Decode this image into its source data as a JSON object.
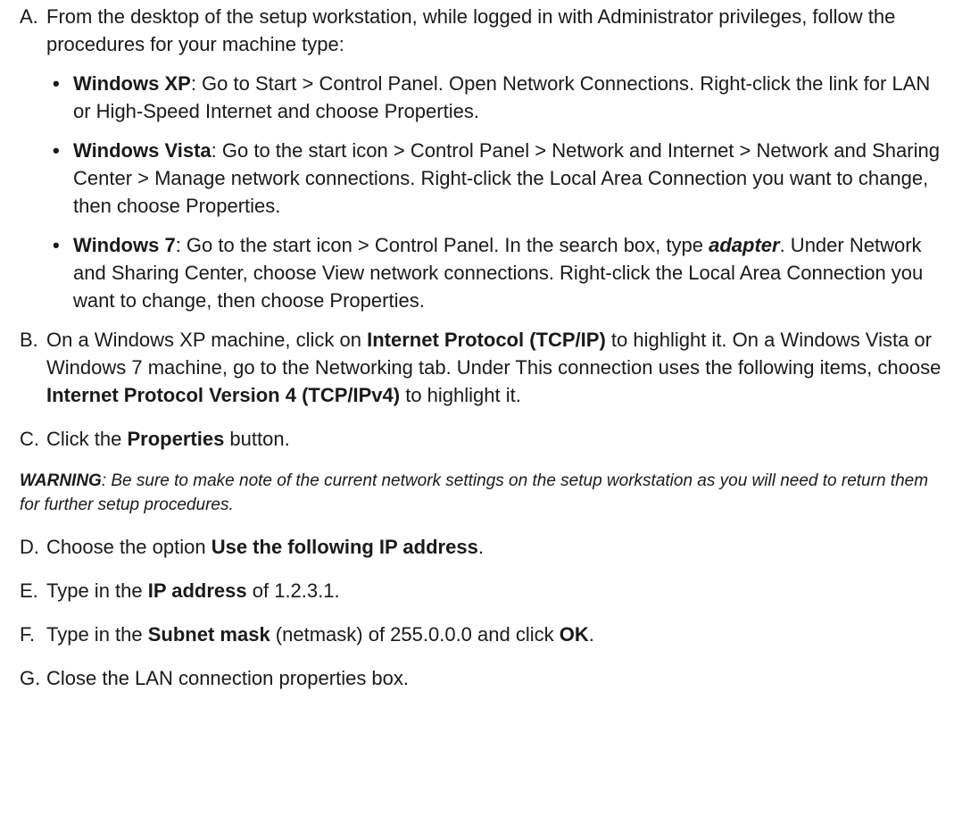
{
  "steps": {
    "a": {
      "letter": "A.",
      "text": "From the desktop of the setup workstation, while logged in with Administrator privileges, follow the procedures for your machine type:",
      "bullets": [
        {
          "label": "Windows XP",
          "text": ": Go to Start > Control Panel. Open Network Connections. Right-click the link for LAN or High-Speed Internet and choose Properties."
        },
        {
          "label": "Windows Vista",
          "text": ": Go to the start icon > Control Panel > Network and Internet > Network and Sharing Center > Manage network connections. Right-click the Local Area Connection you want to change, then choose Properties."
        },
        {
          "label": "Windows 7",
          "text1": ": Go to the start icon > Control Panel. In the search box, type ",
          "emph": "adapter",
          "text2": ". Under Network and Sharing Center, choose View network connections. Right-click the Local Area Connection you want to change, then choose Properties."
        }
      ]
    },
    "b": {
      "letter": "B.",
      "t1": "On a Windows XP machine, click on ",
      "b1": "Internet Protocol (TCP/IP)",
      "t2": " to highlight it. On a Windows Vista or Windows 7 machine, go to the Networking tab. Under This connection uses the following items, choose ",
      "b2": "Internet Protocol Version 4 (TCP/IPv4)",
      "t3": " to highlight it."
    },
    "c": {
      "letter": "C.",
      "t1": "Click the ",
      "b1": "Properties",
      "t2": " button."
    },
    "warning": {
      "label": "WARNING",
      "text": ": Be sure to make note of the current network settings on the setup workstation as you will need to return them for further setup procedures."
    },
    "d": {
      "letter": "D.",
      "t1": "Choose the option ",
      "b1": "Use the following IP address",
      "t2": "."
    },
    "e": {
      "letter": "E.",
      "t1": "Type in the ",
      "b1": "IP address",
      "t2": " of 1.2.3.1."
    },
    "f": {
      "letter": "F.",
      "t1": "Type in the ",
      "b1": "Subnet mask",
      "t2": " (netmask) of 255.0.0.0 and click ",
      "b2": "OK",
      "t3": "."
    },
    "g": {
      "letter": "G.",
      "text": "Close the LAN connection properties box."
    }
  }
}
